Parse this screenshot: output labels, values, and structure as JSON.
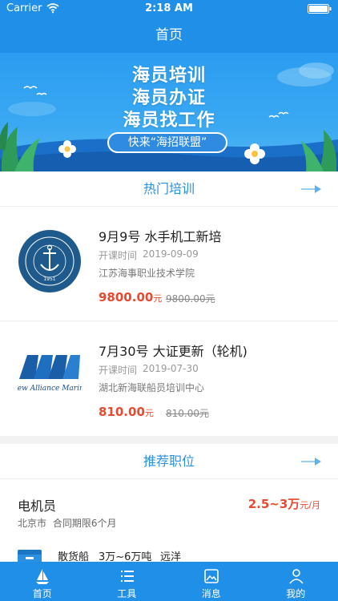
{
  "status_bar": {
    "carrier": "Carrier",
    "time": "2:18 AM"
  },
  "nav": {
    "title": "首页"
  },
  "banner": {
    "line1": "海员培训",
    "line2": "海员办证",
    "line3": "海员找工作",
    "pill_text": "快来“海招联盟”"
  },
  "training": {
    "header": "热门培训",
    "date_label": "开课时间",
    "price_unit": "元",
    "courses": [
      {
        "title": "9月9号 水手机工新培",
        "date": "2019-09-09",
        "school": "江苏海事职业技术学院",
        "price": "9800.00",
        "original_price": "9800.00元"
      },
      {
        "title": "7月30号 大证更新（轮机)",
        "date": "2019-07-30",
        "school": "湖北新海联船员培训中心",
        "price": "810.00",
        "original_price": "810.00元"
      }
    ]
  },
  "logos": {
    "jiangsu_seal_year": "1951",
    "new_alliance": "New Alliance Marine"
  },
  "jobs": {
    "header": "推荐职位",
    "items": [
      {
        "title": "电机员",
        "location": "北京市",
        "contract": "合同期限6个月",
        "salary": "2.5~3万",
        "salary_unit": "元/月"
      }
    ],
    "second_tags": [
      "散货船",
      "3万~6万吨",
      "远洋"
    ]
  },
  "tabs": [
    {
      "label": "首页",
      "icon": "sailboat-icon"
    },
    {
      "label": "工具",
      "icon": "list-icon"
    },
    {
      "label": "消息",
      "icon": "image-icon"
    },
    {
      "label": "我的",
      "icon": "person-icon"
    }
  ],
  "colors": {
    "primary": "#1f8fe8",
    "accent_red": "#e8492f",
    "header_text": "#2a90e0"
  }
}
